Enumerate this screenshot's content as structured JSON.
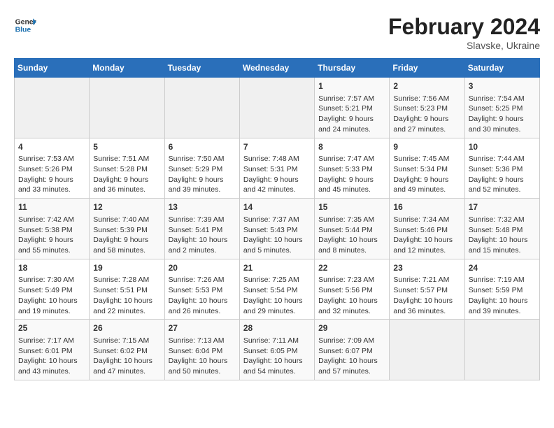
{
  "header": {
    "logo_line1": "General",
    "logo_line2": "Blue",
    "month_year": "February 2024",
    "location": "Slavske, Ukraine"
  },
  "weekdays": [
    "Sunday",
    "Monday",
    "Tuesday",
    "Wednesday",
    "Thursday",
    "Friday",
    "Saturday"
  ],
  "weeks": [
    [
      {
        "day": "",
        "info": ""
      },
      {
        "day": "",
        "info": ""
      },
      {
        "day": "",
        "info": ""
      },
      {
        "day": "",
        "info": ""
      },
      {
        "day": "1",
        "info": "Sunrise: 7:57 AM\nSunset: 5:21 PM\nDaylight: 9 hours\nand 24 minutes."
      },
      {
        "day": "2",
        "info": "Sunrise: 7:56 AM\nSunset: 5:23 PM\nDaylight: 9 hours\nand 27 minutes."
      },
      {
        "day": "3",
        "info": "Sunrise: 7:54 AM\nSunset: 5:25 PM\nDaylight: 9 hours\nand 30 minutes."
      }
    ],
    [
      {
        "day": "4",
        "info": "Sunrise: 7:53 AM\nSunset: 5:26 PM\nDaylight: 9 hours\nand 33 minutes."
      },
      {
        "day": "5",
        "info": "Sunrise: 7:51 AM\nSunset: 5:28 PM\nDaylight: 9 hours\nand 36 minutes."
      },
      {
        "day": "6",
        "info": "Sunrise: 7:50 AM\nSunset: 5:29 PM\nDaylight: 9 hours\nand 39 minutes."
      },
      {
        "day": "7",
        "info": "Sunrise: 7:48 AM\nSunset: 5:31 PM\nDaylight: 9 hours\nand 42 minutes."
      },
      {
        "day": "8",
        "info": "Sunrise: 7:47 AM\nSunset: 5:33 PM\nDaylight: 9 hours\nand 45 minutes."
      },
      {
        "day": "9",
        "info": "Sunrise: 7:45 AM\nSunset: 5:34 PM\nDaylight: 9 hours\nand 49 minutes."
      },
      {
        "day": "10",
        "info": "Sunrise: 7:44 AM\nSunset: 5:36 PM\nDaylight: 9 hours\nand 52 minutes."
      }
    ],
    [
      {
        "day": "11",
        "info": "Sunrise: 7:42 AM\nSunset: 5:38 PM\nDaylight: 9 hours\nand 55 minutes."
      },
      {
        "day": "12",
        "info": "Sunrise: 7:40 AM\nSunset: 5:39 PM\nDaylight: 9 hours\nand 58 minutes."
      },
      {
        "day": "13",
        "info": "Sunrise: 7:39 AM\nSunset: 5:41 PM\nDaylight: 10 hours\nand 2 minutes."
      },
      {
        "day": "14",
        "info": "Sunrise: 7:37 AM\nSunset: 5:43 PM\nDaylight: 10 hours\nand 5 minutes."
      },
      {
        "day": "15",
        "info": "Sunrise: 7:35 AM\nSunset: 5:44 PM\nDaylight: 10 hours\nand 8 minutes."
      },
      {
        "day": "16",
        "info": "Sunrise: 7:34 AM\nSunset: 5:46 PM\nDaylight: 10 hours\nand 12 minutes."
      },
      {
        "day": "17",
        "info": "Sunrise: 7:32 AM\nSunset: 5:48 PM\nDaylight: 10 hours\nand 15 minutes."
      }
    ],
    [
      {
        "day": "18",
        "info": "Sunrise: 7:30 AM\nSunset: 5:49 PM\nDaylight: 10 hours\nand 19 minutes."
      },
      {
        "day": "19",
        "info": "Sunrise: 7:28 AM\nSunset: 5:51 PM\nDaylight: 10 hours\nand 22 minutes."
      },
      {
        "day": "20",
        "info": "Sunrise: 7:26 AM\nSunset: 5:53 PM\nDaylight: 10 hours\nand 26 minutes."
      },
      {
        "day": "21",
        "info": "Sunrise: 7:25 AM\nSunset: 5:54 PM\nDaylight: 10 hours\nand 29 minutes."
      },
      {
        "day": "22",
        "info": "Sunrise: 7:23 AM\nSunset: 5:56 PM\nDaylight: 10 hours\nand 32 minutes."
      },
      {
        "day": "23",
        "info": "Sunrise: 7:21 AM\nSunset: 5:57 PM\nDaylight: 10 hours\nand 36 minutes."
      },
      {
        "day": "24",
        "info": "Sunrise: 7:19 AM\nSunset: 5:59 PM\nDaylight: 10 hours\nand 39 minutes."
      }
    ],
    [
      {
        "day": "25",
        "info": "Sunrise: 7:17 AM\nSunset: 6:01 PM\nDaylight: 10 hours\nand 43 minutes."
      },
      {
        "day": "26",
        "info": "Sunrise: 7:15 AM\nSunset: 6:02 PM\nDaylight: 10 hours\nand 47 minutes."
      },
      {
        "day": "27",
        "info": "Sunrise: 7:13 AM\nSunset: 6:04 PM\nDaylight: 10 hours\nand 50 minutes."
      },
      {
        "day": "28",
        "info": "Sunrise: 7:11 AM\nSunset: 6:05 PM\nDaylight: 10 hours\nand 54 minutes."
      },
      {
        "day": "29",
        "info": "Sunrise: 7:09 AM\nSunset: 6:07 PM\nDaylight: 10 hours\nand 57 minutes."
      },
      {
        "day": "",
        "info": ""
      },
      {
        "day": "",
        "info": ""
      }
    ]
  ]
}
